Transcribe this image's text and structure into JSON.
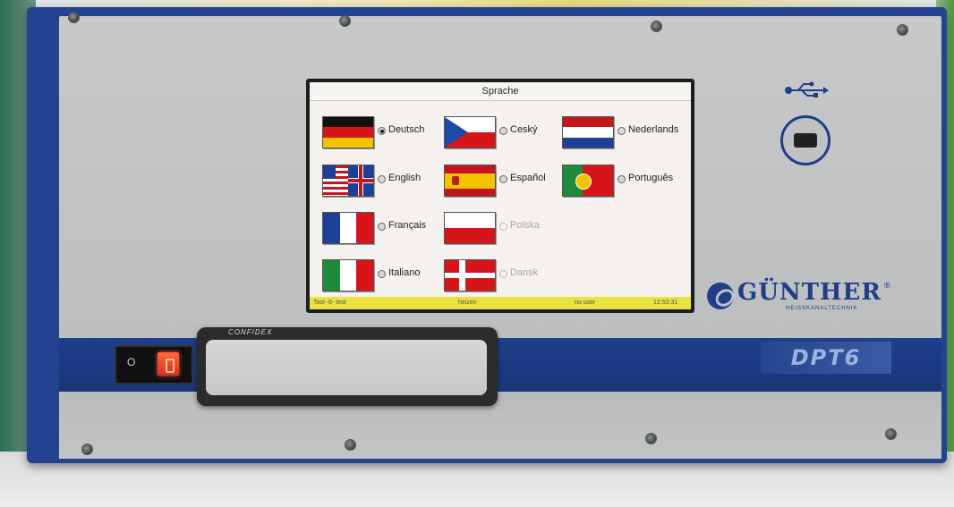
{
  "screen": {
    "title": "Sprache",
    "languages": [
      {
        "label": "Deutsch",
        "flag": "flag-de-icon",
        "selected": true,
        "enabled": true
      },
      {
        "label": "Ceský",
        "flag": "flag-cz-icon",
        "selected": false,
        "enabled": true
      },
      {
        "label": "Nederlands",
        "flag": "flag-nl-icon",
        "selected": false,
        "enabled": true
      },
      {
        "label": "English",
        "flag": "flag-us-uk-icon",
        "selected": false,
        "enabled": true
      },
      {
        "label": "Español",
        "flag": "flag-es-icon",
        "selected": false,
        "enabled": true
      },
      {
        "label": "Português",
        "flag": "flag-pt-icon",
        "selected": false,
        "enabled": true
      },
      {
        "label": "Français",
        "flag": "flag-fr-icon",
        "selected": false,
        "enabled": true
      },
      {
        "label": "Polska",
        "flag": "flag-pl-icon",
        "selected": false,
        "enabled": false
      },
      {
        "label": "Italiano",
        "flag": "flag-it-icon",
        "selected": false,
        "enabled": true
      },
      {
        "label": "Dansk",
        "flag": "flag-dk-icon",
        "selected": false,
        "enabled": false
      }
    ],
    "status": {
      "tool": "Tool -6- test",
      "mode": "heizen",
      "user": "no user",
      "time": "12:53:31"
    }
  },
  "device": {
    "brand": "GÜNTHER",
    "brand_sub": "HEISSKANALTECHNIK",
    "registered": "®",
    "model": "DPT6",
    "panel_label": "CONFIDEX",
    "power_off_symbol": "O"
  },
  "colors": {
    "chassis_blue": "#23428f",
    "status_yellow": "#e9e23f",
    "switch_red": "#e0401f"
  }
}
